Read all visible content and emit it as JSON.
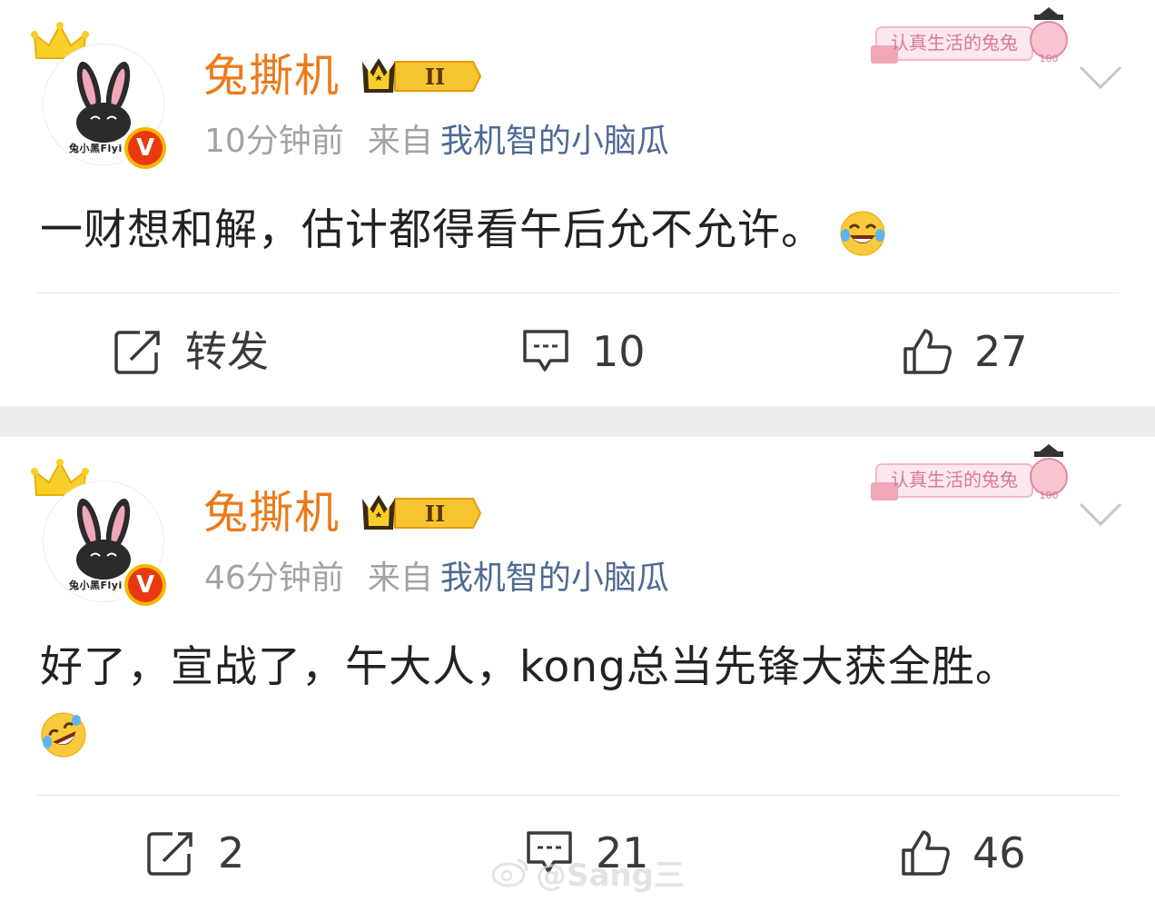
{
  "posts": [
    {
      "username": "兔撕机",
      "avatar_caption": "兔小黑Flyi",
      "verified_badge": "V",
      "rank_label": "II",
      "time": "10分钟前",
      "from_label": "来自",
      "source": "我机智的小脑瓜",
      "stamp_text": "认真生活的兔兔",
      "stamp_score": "100",
      "text": "一财想和解，估计都得看午后允不允许。",
      "emoji": "laugh-cry-emoji",
      "repost_label": "转发",
      "comments": "10",
      "likes": "27"
    },
    {
      "username": "兔撕机",
      "avatar_caption": "兔小黑Flyi",
      "verified_badge": "V",
      "rank_label": "II",
      "time": "46分钟前",
      "from_label": "来自",
      "source": "我机智的小脑瓜",
      "stamp_text": "认真生活的兔兔",
      "stamp_score": "100",
      "text": "好了，宣战了，午大人，kong总当先锋大获全胜。",
      "emoji": "rolling-laugh-emoji",
      "reposts": "2",
      "comments": "21",
      "likes": "46"
    }
  ],
  "watermark": "@Sang三",
  "colors": {
    "username": "#ec7a1a",
    "meta_gray": "#a3a3a3",
    "source_blue": "#4f6a93",
    "separator": "#ededed",
    "verified_red": "#e8390e",
    "badge_gold": "#f7b500"
  }
}
